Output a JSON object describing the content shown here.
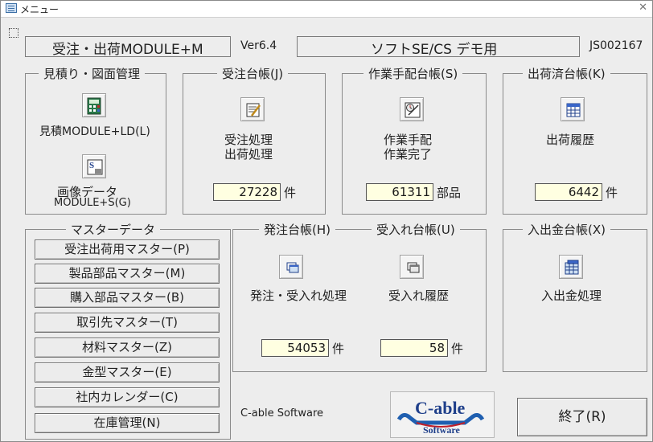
{
  "window": {
    "title": "メニュー",
    "close_glyph": "✕"
  },
  "header": {
    "app_name": "受注・出荷MODULE+M",
    "version": "Ver6.4",
    "edition": "ソフトSE/CS デモ用",
    "serial": "JS002167"
  },
  "groups": {
    "estimate": {
      "label": "見積り・図面管理",
      "estimate_button": "見積MODULE+LD(L)",
      "image_line1": "画像データ",
      "image_line2": "MODULE+S(G)"
    },
    "orders": {
      "label": "受注台帳(J)",
      "line1": "受注処理",
      "line2": "出荷処理",
      "count": "27228",
      "unit": "件"
    },
    "work": {
      "label": "作業手配台帳(S)",
      "line1": "作業手配",
      "line2": "作業完了",
      "count": "61311",
      "unit": "部品"
    },
    "shipped": {
      "label": "出荷済台帳(K)",
      "line1": "出荷履歴",
      "count": "6442",
      "unit": "件"
    },
    "master": {
      "label": "マスターデータ",
      "items": [
        "受注出荷用マスター(P)",
        "製品部品マスター(M)",
        "購入部品マスター(B)",
        "取引先マスター(T)",
        "材料マスター(Z)",
        "金型マスター(E)",
        "社内カレンダー(C)",
        "在庫管理(N)"
      ]
    },
    "purchase": {
      "label": "発注台帳(H)",
      "line1": "発注・受入れ処理",
      "count": "54053",
      "unit": "件"
    },
    "receiving": {
      "label": "受入れ台帳(U)",
      "line1": "受入れ履歴",
      "count": "58",
      "unit": "件"
    },
    "payments": {
      "label": "入出金台帳(X)",
      "line1": "入出金処理"
    }
  },
  "footer": {
    "company": "C-able Software",
    "logo_main": "C-able",
    "logo_sub": "Software",
    "exit_button": "終了(R)"
  },
  "colors": {
    "field_bg": "#ffffe1",
    "logo_blue": "#1f5fb0",
    "logo_red": "#c0202a"
  }
}
